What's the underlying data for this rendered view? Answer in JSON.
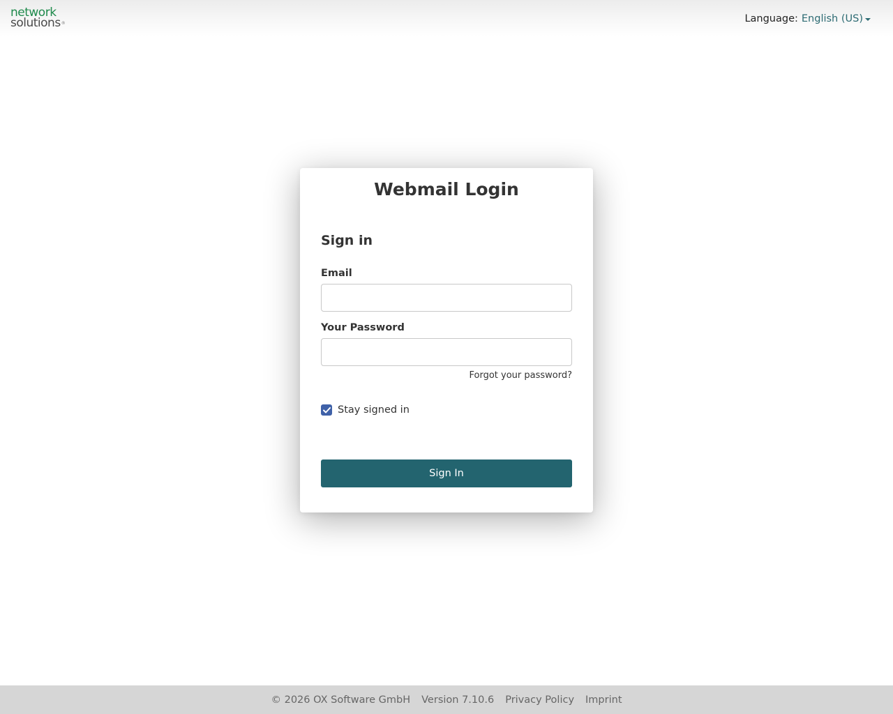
{
  "header": {
    "logo_line1": "network",
    "logo_line2": "solutions",
    "logo_mark": "®",
    "language_label": "Language:",
    "language_value": "English (US)"
  },
  "login": {
    "title": "Webmail Login",
    "subtitle": "Sign in",
    "email_label": "Email",
    "email_value": "",
    "password_label": "Your Password",
    "password_value": "",
    "forgot_link": "Forgot your password?",
    "stay_signed_in_label": "Stay signed in",
    "stay_signed_in_checked": true,
    "sign_in_button": "Sign In"
  },
  "footer": {
    "copyright": "© 2026 OX Software GmbH",
    "version": "Version 7.10.6",
    "privacy": "Privacy Policy",
    "imprint": "Imprint"
  },
  "colors": {
    "accent": "#23646f",
    "brand_green": "#1f8a4c",
    "checkbox": "#3f61a8",
    "language_link": "#2d6b73"
  }
}
